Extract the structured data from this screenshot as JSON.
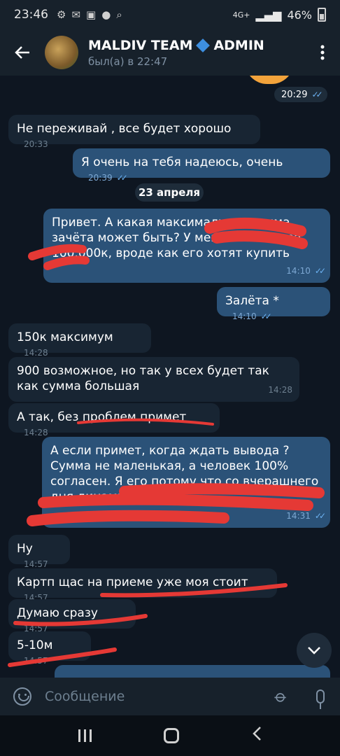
{
  "status_bar": {
    "time": "23:46",
    "network": "4G+",
    "battery": "46%"
  },
  "header": {
    "back_icon": "back-arrow-icon",
    "title_part1": "MALDIV TEAM",
    "title_part2": "ADMIN",
    "subtitle": "был(а) в 22:47"
  },
  "messages": [
    {
      "type": "time_chip",
      "time": "20:29"
    },
    {
      "dir": "in",
      "text": "Не переживай , все будет хорошо",
      "time": "20:33"
    },
    {
      "dir": "out",
      "text": "Я очень на тебя надеюсь, очень",
      "time": "20:39"
    },
    {
      "type": "date",
      "text": "23 апреля"
    },
    {
      "dir": "out",
      "text": "Привет. А какая максимальная сумма зачёта может быть? У меня на стоит за 100.000к, вроде как его хотят купить",
      "time": "14:10"
    },
    {
      "dir": "out",
      "text": "Залёта *",
      "time": "14:10"
    },
    {
      "dir": "in",
      "text": "150к максимум",
      "time": "14:28"
    },
    {
      "dir": "in",
      "text": "900 возможное,  но так у всех будет так как сумма большая",
      "time": "14:28"
    },
    {
      "dir": "in",
      "text": "А так, без проблем примет",
      "time": "14:28"
    },
    {
      "dir": "out",
      "text": "А если примет, когда ждать вывода ? Сумма не маленькая, а человек 100% согласен. Я его потому что со вчерашнего дня динамик",
      "time": "14:31"
    },
    {
      "dir": "in",
      "text": "Ну",
      "time": "14:57"
    },
    {
      "dir": "in",
      "text": "Картп щас на приеме уже моя стоит",
      "time": "14:57"
    },
    {
      "dir": "in",
      "text": "Думаю сразу",
      "time": "14:57"
    },
    {
      "dir": "in",
      "text": "5-10м",
      "time": "14:57"
    }
  ],
  "input": {
    "placeholder": "Сообщение"
  },
  "colors": {
    "background": "#0e1621",
    "incoming_bubble": "#182533",
    "outgoing_bubble": "#2b5278",
    "header": "#17212b",
    "read_ticks": "#6cb2f2",
    "annotation_red": "#e53935"
  }
}
